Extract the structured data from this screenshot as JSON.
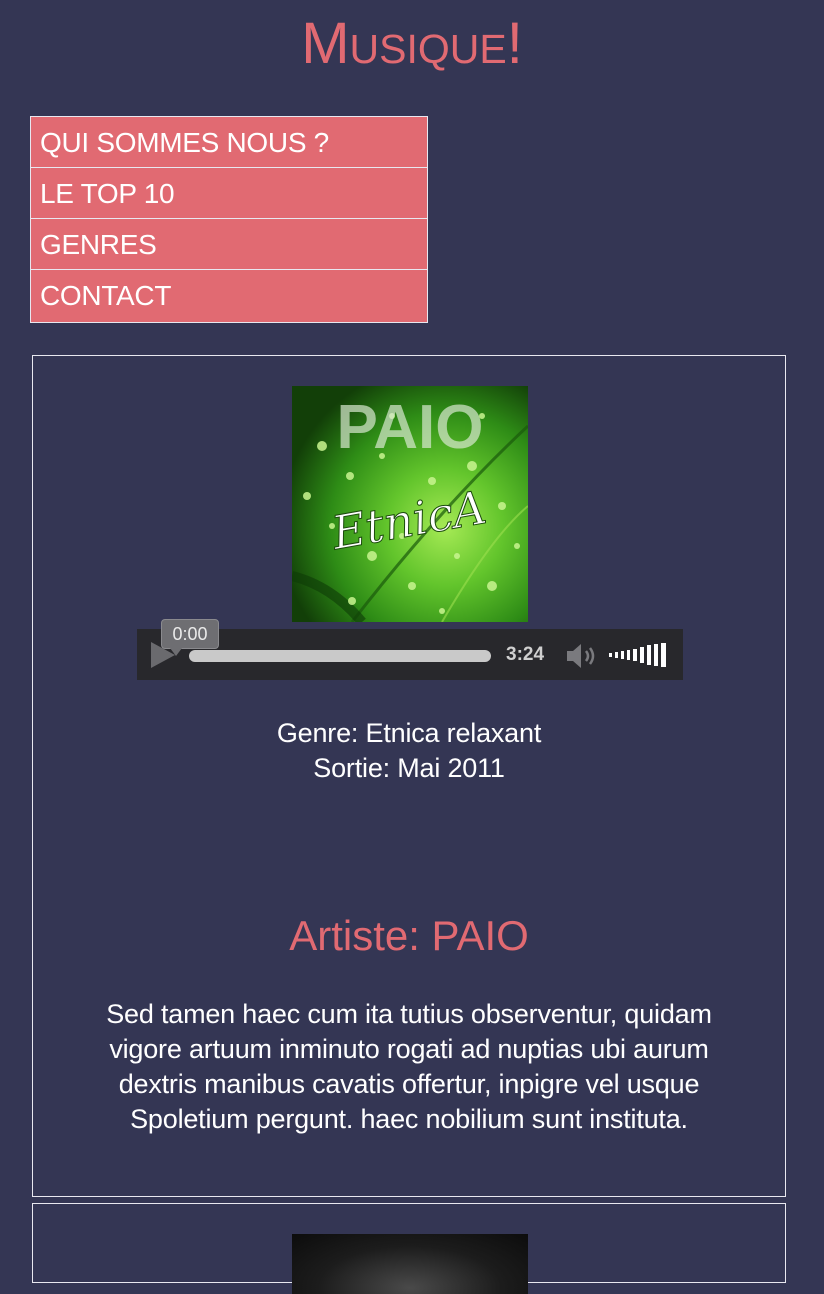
{
  "site": {
    "title": "Musique!",
    "colors": {
      "background": "#343654",
      "accent": "#e16a72",
      "text": "#ffffff"
    }
  },
  "nav": {
    "items": [
      {
        "label": "QUI SOMMES NOUS ?"
      },
      {
        "label": "LE TOP 10"
      },
      {
        "label": "GENRES"
      },
      {
        "label": "CONTACT"
      }
    ]
  },
  "albums": [
    {
      "cover_text_top": "PAIO",
      "cover_text_script": "EtnicA",
      "player": {
        "current_time": "0:00",
        "duration": "3:24",
        "progress": 0,
        "icons": [
          "play-icon",
          "volume-icon",
          "volume-level-icon"
        ]
      },
      "genre": "Genre: Etnica relaxant",
      "release": "Sortie: Mai 2011",
      "artist": "Artiste: PAIO",
      "description": "Sed tamen haec cum ita tutius observentur, quidam vigore artuum inminuto rogati ad nuptias ubi aurum dextris manibus cavatis offertur, inpigre vel usque Spoletium pergunt. haec nobilium sunt instituta."
    }
  ]
}
